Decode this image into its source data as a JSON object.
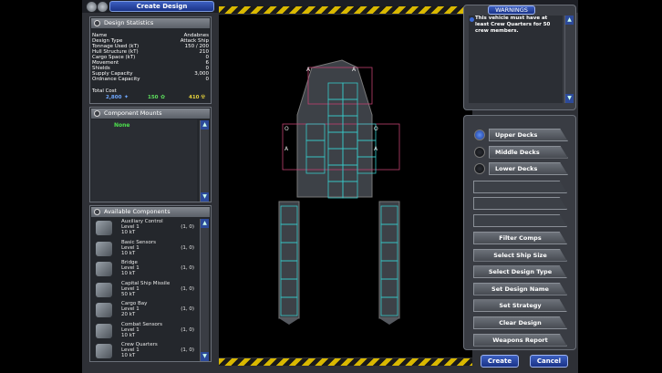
{
  "window": {
    "title": "Create Design"
  },
  "design_statistics": {
    "header": "Design Statistics",
    "rows": [
      {
        "label": "Name",
        "value": "Andabnes"
      },
      {
        "label": "Design Type",
        "value": "Attack Ship"
      },
      {
        "label": "Tonnage Used (kT)",
        "value": "150 / 200"
      },
      {
        "label": "Hull Structure (kT)",
        "value": "210"
      },
      {
        "label": "Cargo Space (kT)",
        "value": "0"
      },
      {
        "label": "Movement",
        "value": "6"
      },
      {
        "label": "Shields",
        "value": "0"
      },
      {
        "label": "Supply Capacity",
        "value": "3,000"
      },
      {
        "label": "Ordnance Capacity",
        "value": "0"
      }
    ],
    "total_cost_label": "Total Cost",
    "cost_a": "2,800",
    "cost_b": "150",
    "cost_c": "410"
  },
  "component_mounts": {
    "header": "Component Mounts",
    "value": "None"
  },
  "available_components": {
    "header": "Available Components",
    "items": [
      {
        "name": "Auxiliary Control",
        "level": "Level 1",
        "size": "10 kT",
        "count": "(1, 0)"
      },
      {
        "name": "Basic Sensors",
        "level": "Level 1",
        "size": "10 kT",
        "count": "(1, 0)"
      },
      {
        "name": "Bridge",
        "level": "Level 1",
        "size": "10 kT",
        "count": "(1, 0)"
      },
      {
        "name": "Capital Ship Missile",
        "level": "Level 1",
        "size": "50 kT",
        "count": "(1, 0)"
      },
      {
        "name": "Cargo Bay",
        "level": "Level 1",
        "size": "20 kT",
        "count": "(1, 0)"
      },
      {
        "name": "Combat Sensors",
        "level": "Level 1",
        "size": "10 kT",
        "count": "(1, 0)"
      },
      {
        "name": "Crew Quarters",
        "level": "Level 1",
        "size": "10 kT",
        "count": "(1, 0)"
      }
    ]
  },
  "warnings": {
    "header": "WARNINGS",
    "text": "This vehicle must have at least Crew Quarters for 50 crew members."
  },
  "decks": [
    "Upper Decks",
    "Middle Decks",
    "Lower Decks"
  ],
  "actions": [
    "Filter Comps",
    "Select Ship Size",
    "Select Design Type",
    "Set Design Name",
    "Set Strategy",
    "Clear Design",
    "Weapons Report"
  ],
  "footer": {
    "create": "Create",
    "cancel": "Cancel"
  }
}
